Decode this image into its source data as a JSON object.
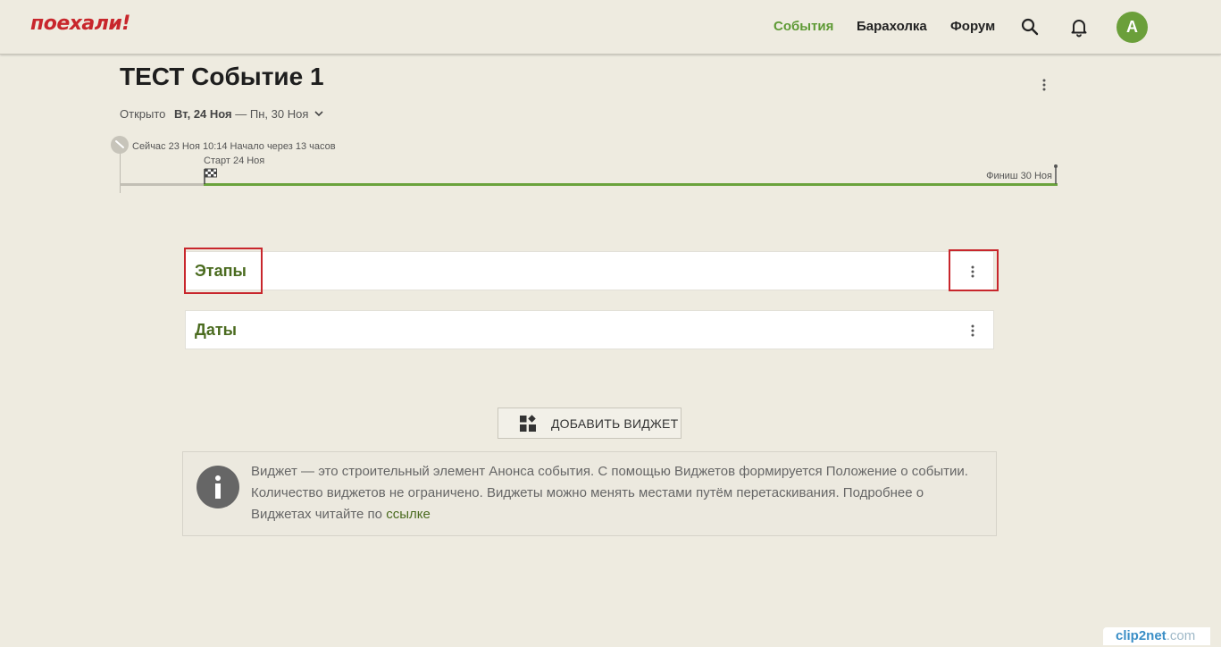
{
  "header": {
    "logo": "поехали!",
    "nav": [
      {
        "label": "События",
        "active": true
      },
      {
        "label": "Барахолка",
        "active": false
      },
      {
        "label": "Форум",
        "active": false
      }
    ],
    "avatar_letter": "A",
    "colors": {
      "brand": "#c8262c",
      "accent": "#5e9a35",
      "avatar": "#6b9f3a"
    },
    "icons": [
      "search-icon",
      "bell-icon"
    ]
  },
  "event": {
    "title": "ТЕСТ Событие 1",
    "status": "Открыто",
    "start_date": "Вт, 24 Ноя",
    "dash": " — ",
    "end_date": "Пн, 30 Ноя"
  },
  "timeline": {
    "now": "Сейчас 23 Ноя 10:14 Начало через 13 часов",
    "start": "Старт 24 Ноя",
    "finish": "Финиш 30 Ноя"
  },
  "widgets": [
    {
      "title": "Этапы"
    },
    {
      "title": "Даты"
    }
  ],
  "add_widget_label": "ДОБАВИТЬ ВИДЖЕТ",
  "info": {
    "text": "Виджет — это строительный элемент Анонса события. С помощью Виджетов формируется Положение о событии. Количество виджетов не ограничено. Виджеты можно менять местами путём перетаскивания. Подробнее о Виджетах читайте по ",
    "link": "ссылке"
  },
  "watermark": {
    "brand": "clip2net",
    "domain": ".com"
  }
}
